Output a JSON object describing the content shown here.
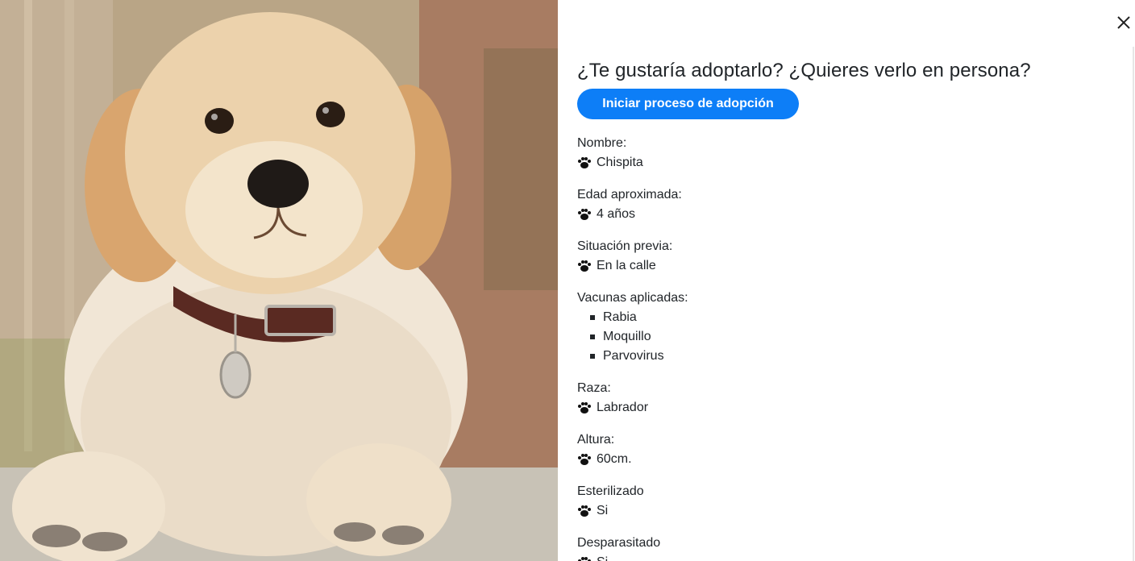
{
  "dialog": {
    "question": "¿Te gustaría adoptarlo? ¿Quieres verlo en persona?",
    "adopt_button": "Iniciar proceso de adopción",
    "close_icon": "close-icon"
  },
  "photo": {
    "subject": "golden-retriever-puppy-photo"
  },
  "pet": {
    "name_label": "Nombre:",
    "name_value": "Chispita",
    "age_label": "Edad aproximada:",
    "age_value": "4 años",
    "situation_label": "Situación previa:",
    "situation_value": "En la calle",
    "vaccines_label": "Vacunas aplicadas:",
    "vaccines": [
      "Rabia",
      "Moquillo",
      "Parvovirus"
    ],
    "breed_label": "Raza:",
    "breed_value": "Labrador",
    "height_label": "Altura:",
    "height_value": "60cm.",
    "sterilized_label": "Esterilizado",
    "sterilized_value": "Si",
    "dewormed_label": "Desparasitado",
    "dewormed_value": "Si"
  },
  "colors": {
    "accent": "#0d7ef7",
    "text": "#212529"
  }
}
